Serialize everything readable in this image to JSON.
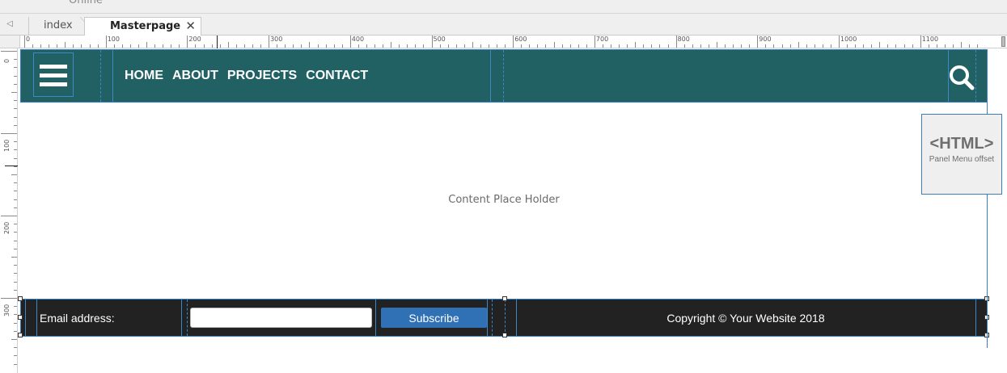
{
  "top_strip": {
    "label": "Online"
  },
  "tabs": [
    {
      "label": "index",
      "active": false
    },
    {
      "label": "Masterpage",
      "active": true
    }
  ],
  "ruler": {
    "top_labels": [
      "0",
      "100",
      "200",
      "300",
      "400",
      "500",
      "600",
      "700",
      "800",
      "900",
      "1000",
      "1100"
    ],
    "left_labels": [
      "0",
      "100",
      "200",
      "300"
    ]
  },
  "header": {
    "nav": [
      "HOME",
      "ABOUT",
      "PROJECTS",
      "CONTACT"
    ],
    "background": "#216164",
    "menu_icon": "hamburger-icon",
    "search_icon": "search-icon"
  },
  "content": {
    "placeholder": "Content Place Holder"
  },
  "footer": {
    "email_label": "Email address:",
    "email_value": "",
    "subscribe_label": "Subscribe",
    "copyright": "Copyright © Your Website 2018",
    "background": "#222222",
    "button_color": "#3071b5"
  },
  "html_widget": {
    "tag": "<HTML>",
    "caption": "Panel Menu offset"
  }
}
